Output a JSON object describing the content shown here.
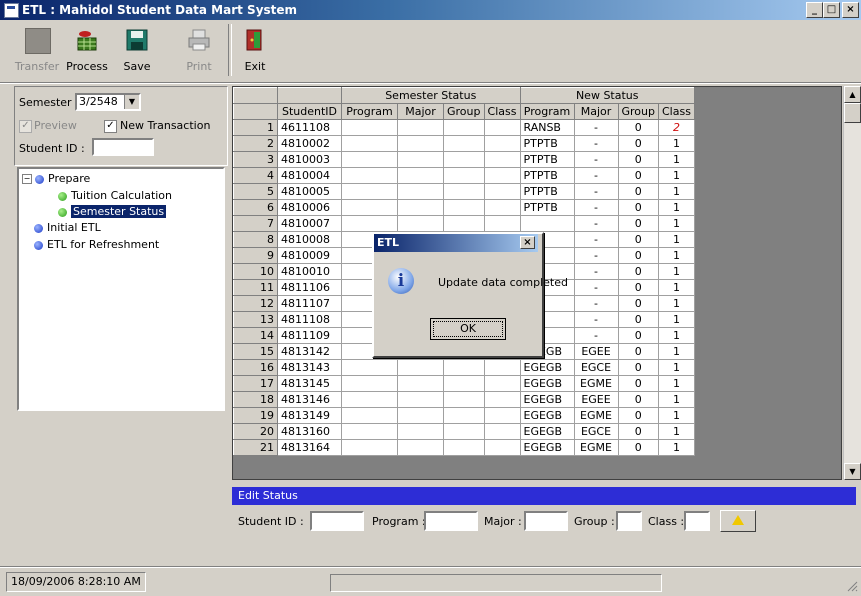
{
  "window": {
    "title": "ETL : Mahidol Student Data Mart System",
    "minimize": "_",
    "maximize": "□",
    "close": "×"
  },
  "toolbar": {
    "transfer": "Transfer",
    "process": "Process",
    "save": "Save",
    "print": "Print",
    "exit": "Exit"
  },
  "filters": {
    "semester_label": "Semester :",
    "semester_value": "3/2548",
    "preview_label": "Preview",
    "preview_checked": true,
    "new_transaction_label": "New Transaction",
    "new_transaction_checked": true,
    "student_id_label": "Student ID :",
    "student_id_value": ""
  },
  "tree": {
    "prepare": "Prepare",
    "tuition": "Tuition Calculation",
    "semester_status": "Semester Status",
    "initial_etl": "Initial ETL",
    "etl_refresh": "ETL for Refreshment"
  },
  "grid": {
    "group_semester": "Semester Status",
    "group_new": "New Status",
    "headers": [
      "StudentID",
      "Program",
      "Major",
      "Group",
      "Class",
      "Program",
      "Major",
      "Group",
      "Class"
    ],
    "rows": [
      {
        "n": "1",
        "id": "4611108",
        "prog": "RANSB",
        "major": "-",
        "group": "0",
        "cls": "2"
      },
      {
        "n": "2",
        "id": "4810002",
        "prog": "PTPTB",
        "major": "-",
        "group": "0",
        "cls": "1"
      },
      {
        "n": "3",
        "id": "4810003",
        "prog": "PTPTB",
        "major": "-",
        "group": "0",
        "cls": "1"
      },
      {
        "n": "4",
        "id": "4810004",
        "prog": "PTPTB",
        "major": "-",
        "group": "0",
        "cls": "1"
      },
      {
        "n": "5",
        "id": "4810005",
        "prog": "PTPTB",
        "major": "-",
        "group": "0",
        "cls": "1"
      },
      {
        "n": "6",
        "id": "4810006",
        "prog": "PTPTB",
        "major": "-",
        "group": "0",
        "cls": "1"
      },
      {
        "n": "7",
        "id": "4810007",
        "prog": "",
        "major": "-",
        "group": "0",
        "cls": "1"
      },
      {
        "n": "8",
        "id": "4810008",
        "prog": "",
        "major": "-",
        "group": "0",
        "cls": "1"
      },
      {
        "n": "9",
        "id": "4810009",
        "prog": "",
        "major": "-",
        "group": "0",
        "cls": "1"
      },
      {
        "n": "10",
        "id": "4810010",
        "prog": "",
        "major": "-",
        "group": "0",
        "cls": "1"
      },
      {
        "n": "11",
        "id": "4811106",
        "prog": "",
        "major": "-",
        "group": "0",
        "cls": "1"
      },
      {
        "n": "12",
        "id": "4811107",
        "prog": "",
        "major": "-",
        "group": "0",
        "cls": "1"
      },
      {
        "n": "13",
        "id": "4811108",
        "prog": "",
        "major": "-",
        "group": "0",
        "cls": "1"
      },
      {
        "n": "14",
        "id": "4811109",
        "prog": "",
        "major": "-",
        "group": "0",
        "cls": "1"
      },
      {
        "n": "15",
        "id": "4813142",
        "prog": "EGEGB",
        "major": "EGEE",
        "group": "0",
        "cls": "1"
      },
      {
        "n": "16",
        "id": "4813143",
        "prog": "EGEGB",
        "major": "EGCE",
        "group": "0",
        "cls": "1"
      },
      {
        "n": "17",
        "id": "4813145",
        "prog": "EGEGB",
        "major": "EGME",
        "group": "0",
        "cls": "1"
      },
      {
        "n": "18",
        "id": "4813146",
        "prog": "EGEGB",
        "major": "EGEE",
        "group": "0",
        "cls": "1"
      },
      {
        "n": "19",
        "id": "4813149",
        "prog": "EGEGB",
        "major": "EGME",
        "group": "0",
        "cls": "1"
      },
      {
        "n": "20",
        "id": "4813160",
        "prog": "EGEGB",
        "major": "EGCE",
        "group": "0",
        "cls": "1"
      },
      {
        "n": "21",
        "id": "4813164",
        "prog": "EGEGB",
        "major": "EGME",
        "group": "0",
        "cls": "1"
      }
    ]
  },
  "edit": {
    "title": "Edit Status",
    "student_id_label": "Student ID :",
    "program_label": "Program :",
    "major_label": "Major :",
    "group_label": "Group :",
    "class_label": "Class :"
  },
  "status": {
    "datetime": "18/09/2006 8:28:10 AM"
  },
  "dialog": {
    "title": "ETL",
    "close": "×",
    "icon": "i",
    "message": "Update data completed",
    "ok": "OK"
  }
}
